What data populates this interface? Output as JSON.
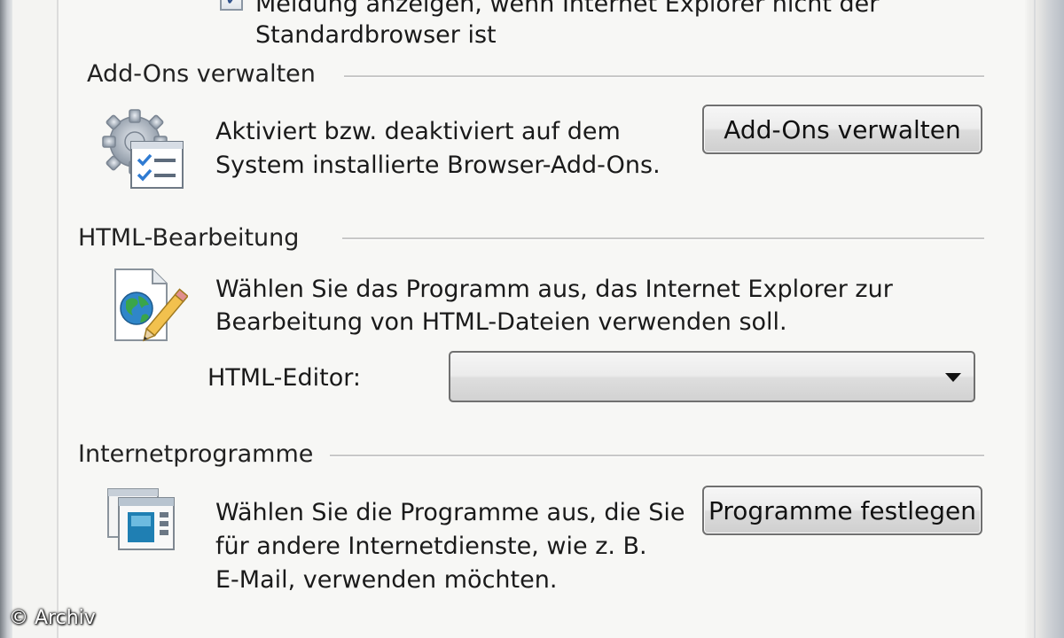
{
  "default_browser": {
    "checkbox_checked": true,
    "line1": "Meldung anzeigen, wenn Internet Explorer nicht der",
    "line2": "Standardbrowser ist"
  },
  "addons": {
    "group_title": "Add-Ons verwalten",
    "icon": "gear-checklist-icon",
    "desc_line1": "Aktiviert bzw. deaktiviert auf dem",
    "desc_line2": "System installierte Browser-Add-Ons.",
    "button_label": "Add-Ons verwalten"
  },
  "html_editing": {
    "group_title": "HTML-Bearbeitung",
    "icon": "html-document-edit-icon",
    "desc_line1": "Wählen Sie das Programm aus, das Internet Explorer zur",
    "desc_line2": "Bearbeitung von HTML-Dateien verwenden soll.",
    "editor_label": "HTML-Editor:",
    "editor_value": ""
  },
  "internet_programs": {
    "group_title": "Internetprogramme",
    "icon": "programs-window-icon",
    "desc_line1": "Wählen Sie die Programme aus, die Sie",
    "desc_line2": "für andere Internetdienste, wie z. B.",
    "desc_line3": "E-Mail, verwenden möchten.",
    "button_label": "Programme festlegen"
  },
  "watermark": "© Archiv"
}
